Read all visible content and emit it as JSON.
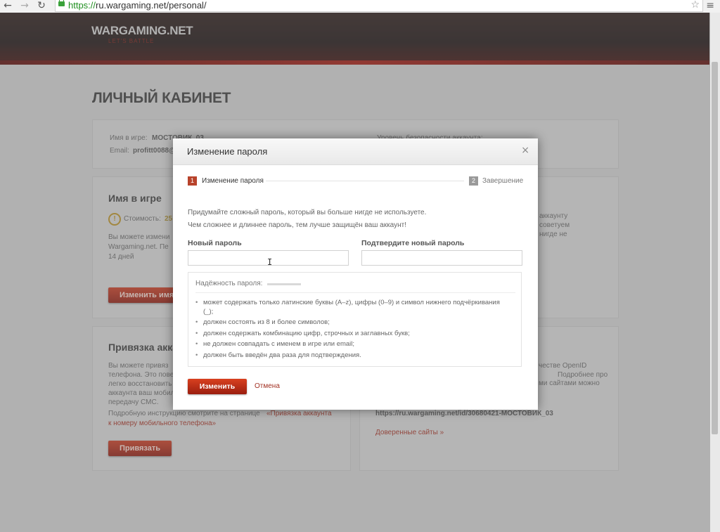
{
  "browser": {
    "back_icon": "arrow-left-icon",
    "forward_icon": "arrow-right-icon",
    "reload_icon": "reload-icon",
    "url_protocol": "https://",
    "url_rest": "ru.wargaming.net/personal/"
  },
  "header": {
    "logo": "WARGAMING.NET",
    "tagline": "LET'S BATTLE"
  },
  "page": {
    "title": "ЛИЧНЫЙ КАБИНЕТ",
    "account": {
      "name_label": "Имя в игре:",
      "name_value": "МОСТОВИК_03",
      "email_label": "Email:",
      "email_value": "profitt0088@",
      "security_level": "Уровень безопасности аккаунта:"
    },
    "name_panel": {
      "heading": "Имя в игре",
      "cost_label": "Стоимость:",
      "cost_value": "25",
      "desc1": "Вы можете измени",
      "desc2": "Wargaming.net. Пе",
      "desc3": "14 дней",
      "button": "Изменить имя"
    },
    "password_panel": {
      "desc1": "аккаунту",
      "desc2": "советуем",
      "desc3": "нигде не"
    },
    "phone_panel": {
      "heading": "Привязка акка",
      "desc1": "Вы можете привяз",
      "desc2": "телефона. Это пове",
      "desc3": "легко восстановить",
      "desc4": "аккаунта ваш мобил",
      "desc5": "передачу СМС.",
      "instr1": "Подробную инструкцию смотрите на странице",
      "instr_link1": "«Привязка аккаунта",
      "instr_link2": "к номеру мобильного телефона»",
      "button": "Привязать"
    },
    "openid_panel": {
      "desc1": "честве OpenID",
      "desc2": "ми сайтами можно",
      "desc3": "Подробнее про",
      "url": "https://ru.wargaming.net/id/30680421-МОСТОВИК_03",
      "trusted": "Доверенные сайты »"
    }
  },
  "modal": {
    "title": "Изменение пароля",
    "step1_num": "1",
    "step1_label": "Изменение пароля",
    "step2_num": "2",
    "step2_label": "Завершение",
    "intro1": "Придумайте сложный пароль, который вы больше нигде не используете.",
    "intro2": "Чем сложнее и длиннее пароль, тем лучше защищён ваш аккаунт!",
    "new_password_label": "Новый пароль",
    "confirm_password_label": "Подтвердите новый пароль",
    "new_password_value": "",
    "confirm_password_value": "",
    "strength_label": "Надёжность пароля:",
    "hints": [
      "может содержать только латинские буквы (A–z), цифры (0–9) и символ нижнего подчёркивания (_);",
      "должен состоять из 8 и более символов;",
      "должен содержать комбинацию цифр, строчных и заглавных букв;",
      "не должен совпадать с именем в игре или email;",
      "должен быть введён два раза для подтверждения."
    ],
    "submit": "Изменить",
    "cancel": "Отмена"
  },
  "colors": {
    "accent_red": "#c7391f",
    "step_active": "#b8432b",
    "step_inactive": "#9a9a9a"
  }
}
